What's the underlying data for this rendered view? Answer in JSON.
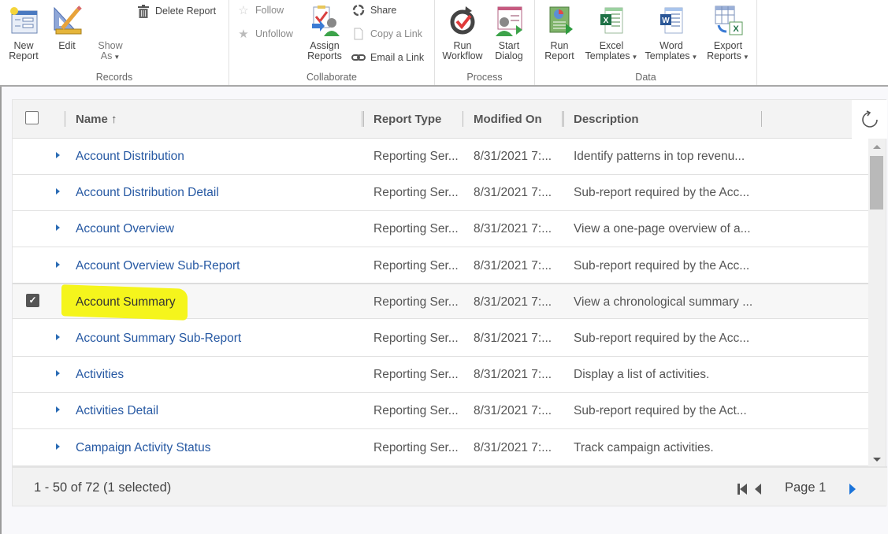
{
  "ribbon": {
    "groups": {
      "records": "Records",
      "collaborate": "Collaborate",
      "process": "Process",
      "data": "Data"
    },
    "new_report": [
      "New",
      "Report"
    ],
    "edit": "Edit",
    "show_as": [
      "Show",
      "As"
    ],
    "delete_report": "Delete Report",
    "follow": "Follow",
    "unfollow": "Unfollow",
    "assign_reports": [
      "Assign",
      "Reports"
    ],
    "share": "Share",
    "copy_link": "Copy a Link",
    "email_link": "Email a Link",
    "run_workflow": [
      "Run",
      "Workflow"
    ],
    "start_dialog": [
      "Start",
      "Dialog"
    ],
    "run_report": [
      "Run",
      "Report"
    ],
    "excel_templates": [
      "Excel",
      "Templates"
    ],
    "word_templates": [
      "Word",
      "Templates"
    ],
    "export_reports": [
      "Export",
      "Reports"
    ]
  },
  "grid": {
    "columns": {
      "name": "Name ↑",
      "report_type": "Report Type",
      "modified_on": "Modified On",
      "description": "Description"
    },
    "rows": [
      {
        "name": "Account Distribution",
        "type": "Reporting Ser...",
        "modified": "8/31/2021 7:...",
        "desc": "Identify patterns in top revenu...",
        "selected": false
      },
      {
        "name": "Account Distribution Detail",
        "type": "Reporting Ser...",
        "modified": "8/31/2021 7:...",
        "desc": "Sub-report required by the Acc...",
        "selected": false
      },
      {
        "name": "Account Overview",
        "type": "Reporting Ser...",
        "modified": "8/31/2021 7:...",
        "desc": "View a one-page overview of a...",
        "selected": false
      },
      {
        "name": "Account Overview Sub-Report",
        "type": "Reporting Ser...",
        "modified": "8/31/2021 7:...",
        "desc": "Sub-report required by the Acc...",
        "selected": false
      },
      {
        "name": "Account Summary",
        "type": "Reporting Ser...",
        "modified": "8/31/2021 7:...",
        "desc": "View a chronological summary ...",
        "selected": true
      },
      {
        "name": "Account Summary Sub-Report",
        "type": "Reporting Ser...",
        "modified": "8/31/2021 7:...",
        "desc": "Sub-report required by the Acc...",
        "selected": false
      },
      {
        "name": "Activities",
        "type": "Reporting Ser...",
        "modified": "8/31/2021 7:...",
        "desc": "Display a list of activities.",
        "selected": false
      },
      {
        "name": "Activities Detail",
        "type": "Reporting Ser...",
        "modified": "8/31/2021 7:...",
        "desc": "Sub-report required by the Act...",
        "selected": false
      },
      {
        "name": "Campaign Activity Status",
        "type": "Reporting Ser...",
        "modified": "8/31/2021 7:...",
        "desc": "Track campaign activities.",
        "selected": false
      }
    ],
    "footer": {
      "count": "1 - 50 of 72 (1 selected)",
      "page": "Page 1"
    },
    "colors": {
      "link": "#2759a3",
      "highlight": "#f5f51c",
      "pager_next": "#1a73d9"
    }
  }
}
